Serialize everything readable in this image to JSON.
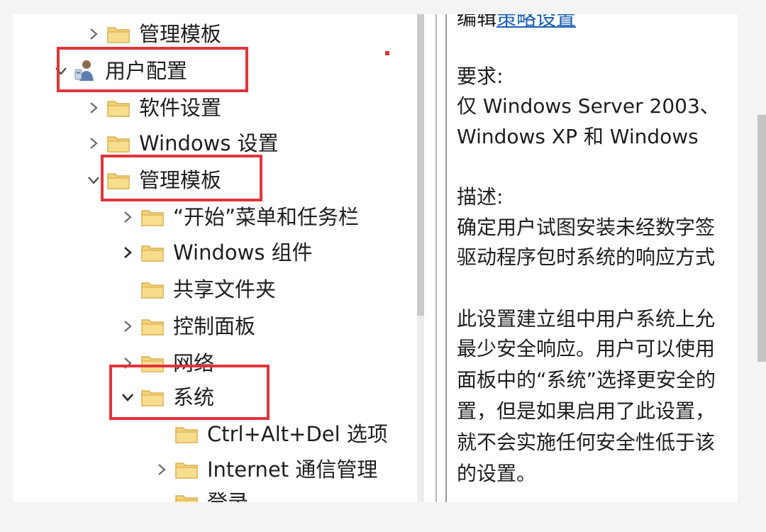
{
  "tree": {
    "items": [
      {
        "label": "管理模板",
        "expander": "collapsed",
        "icon": "folder-icon"
      },
      {
        "label": "用户配置",
        "expander": "expanded",
        "icon": "user-config-icon"
      },
      {
        "label": "软件设置",
        "expander": "collapsed",
        "icon": "folder-icon"
      },
      {
        "label": "Windows 设置",
        "expander": "collapsed",
        "icon": "folder-icon"
      },
      {
        "label": "管理模板",
        "expander": "expanded",
        "icon": "folder-icon"
      },
      {
        "label": "“开始”菜单和任务栏",
        "expander": "collapsed",
        "icon": "folder-icon"
      },
      {
        "label": "Windows 组件",
        "expander": "collapsed",
        "icon": "folder-icon"
      },
      {
        "label": "共享文件夹",
        "expander": "none",
        "icon": "folder-icon"
      },
      {
        "label": "控制面板",
        "expander": "collapsed",
        "icon": "folder-icon"
      },
      {
        "label": "网络",
        "expander": "collapsed",
        "icon": "folder-icon"
      },
      {
        "label": "系统",
        "expander": "expanded",
        "icon": "folder-icon"
      },
      {
        "label": "Ctrl+Alt+Del 选项",
        "expander": "none",
        "icon": "folder-icon"
      },
      {
        "label": "Internet 通信管理",
        "expander": "collapsed",
        "icon": "folder-icon"
      },
      {
        "label": "登录",
        "expander": "none",
        "icon": "folder-icon"
      }
    ]
  },
  "description": {
    "edit_prefix": "编辑",
    "edit_link": "策略设置",
    "requirements_heading": "要求:",
    "requirements_lines": [
      "仅 Windows Server 2003、",
      "Windows XP 和 Windows"
    ],
    "description_heading": "描述:",
    "description_lines": [
      "确定用户试图安装未经数字签",
      "驱动程序包时系统的响应方式"
    ],
    "detail_lines": [
      "此设置建立组中用户系统上允",
      "最少安全响应。用户可以使用",
      "面板中的“系统”选择更安全的",
      "置，但是如果启用了此设置，",
      "就不会实施任何安全性低于该",
      "的设置。"
    ]
  },
  "colors": {
    "highlight": "#e0343a",
    "link": "#1a5fb4",
    "folder": "#f3d27a"
  }
}
